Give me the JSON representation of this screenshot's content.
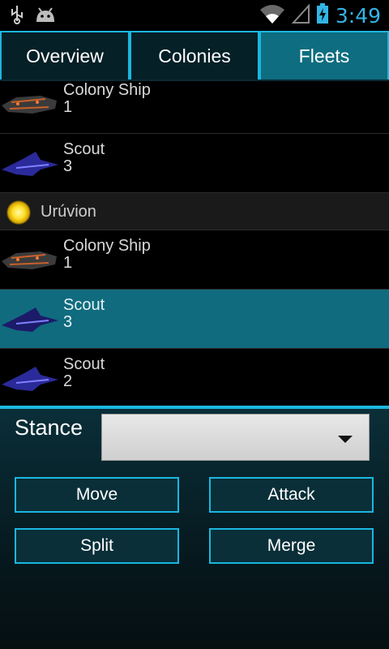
{
  "status_bar": {
    "time": "3:49"
  },
  "tabs": [
    {
      "label": "Overview",
      "active": false
    },
    {
      "label": "Colonies",
      "active": false
    },
    {
      "label": "Fleets",
      "active": true
    }
  ],
  "fleet_list": {
    "rows": [
      {
        "type": "ship",
        "name": "Colony Ship",
        "count": "1",
        "ship_class": "colony"
      },
      {
        "type": "ship",
        "name": "Scout",
        "count": "3",
        "ship_class": "scout"
      },
      {
        "type": "system",
        "name": "Urúvion"
      },
      {
        "type": "ship",
        "name": "Colony Ship",
        "count": "1",
        "ship_class": "colony"
      },
      {
        "type": "ship",
        "name": "Scout",
        "count": "3",
        "ship_class": "scout",
        "selected": true
      },
      {
        "type": "ship",
        "name": "Scout",
        "count": "2",
        "ship_class": "scout"
      }
    ]
  },
  "panel": {
    "stance_label": "Stance",
    "stance_value": "",
    "buttons": {
      "move": "Move",
      "attack": "Attack",
      "split": "Split",
      "merge": "Merge"
    }
  },
  "colors": {
    "accent": "#1ab7e0",
    "selected_row": "#106b7e",
    "clock": "#33b5e5"
  }
}
